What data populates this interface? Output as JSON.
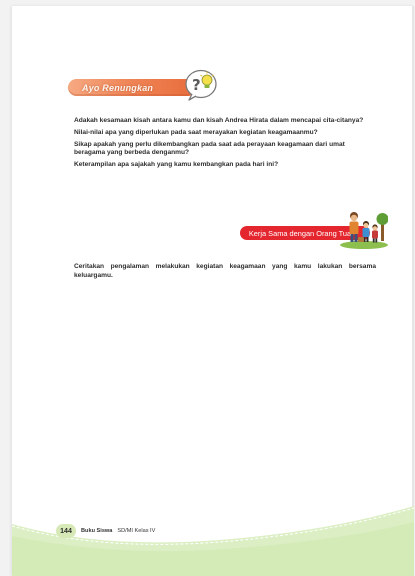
{
  "reflect_section": {
    "title": "Ayo Renungkan",
    "icon": "question-idea-bubble-icon"
  },
  "questions": [
    "Adakah kesamaan kisah antara kamu dan kisah Andrea Hirata dalam mencapai cita-citanya?",
    "Nilai-nilai apa yang diperlukan pada saat merayakan kegiatan keagamaanmu?",
    "Sikap apakah yang perlu dikembangkan pada saat ada perayaan keagamaan dari umat beragama yang berbeda denganmu?",
    "Keterampilan apa sajakah yang kamu kembangkan pada hari ini?"
  ],
  "family_section": {
    "title": "Kerja Sama dengan Orang Tua",
    "icon": "family-illustration-icon"
  },
  "task": "Ceritakan pengalaman melakukan kegiatan keagamaan yang kamu lakukan bersama keluargamu.",
  "footer": {
    "page_number": "144",
    "book_title": "Buku Siswa",
    "book_subtitle": "SD/MI Kelas IV"
  },
  "colors": {
    "reflect_pill": "#ef8355",
    "family_pill": "#e4262f",
    "footer_wave": "#dcefc4"
  }
}
